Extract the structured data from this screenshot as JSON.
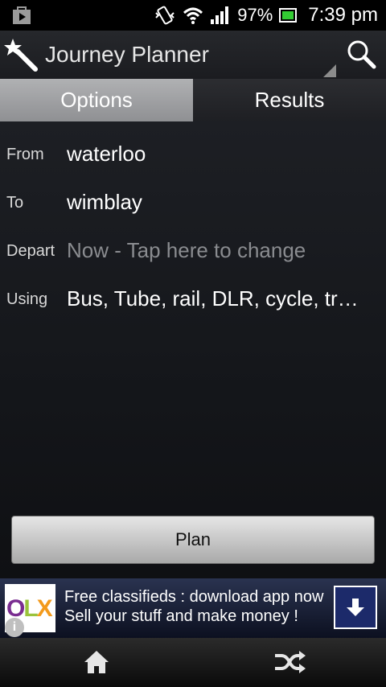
{
  "status": {
    "battery_percent": "97%",
    "time": "7:39 pm",
    "icons": [
      "store-icon",
      "vibrate-icon",
      "wifi-icon",
      "signal-icon",
      "battery-icon"
    ]
  },
  "actionbar": {
    "title": "Journey Planner",
    "icons": [
      "magic-wand-icon",
      "search-icon"
    ]
  },
  "tabs": [
    {
      "label": "Options",
      "active": true
    },
    {
      "label": "Results",
      "active": false
    }
  ],
  "form": {
    "from": {
      "label": "From",
      "value": "waterloo"
    },
    "to": {
      "label": "To",
      "value": "wimblay"
    },
    "depart": {
      "label": "Depart",
      "value": "Now  -  Tap here to change"
    },
    "using": {
      "label": "Using",
      "value": "Bus, Tube, rail, DLR, cycle, tram, river"
    }
  },
  "plan_button": "Plan",
  "ad": {
    "logo": "OLX",
    "line1": "Free classifieds : download app now",
    "line2": "Sell your stuff and make money !",
    "info": "i"
  },
  "navbar": {
    "icons": [
      "home-icon",
      "shuffle-icon"
    ]
  },
  "colors": {
    "tab_active": "#a0a1a3",
    "background": "#0f1013",
    "ad_button": "#1c2a6a"
  }
}
